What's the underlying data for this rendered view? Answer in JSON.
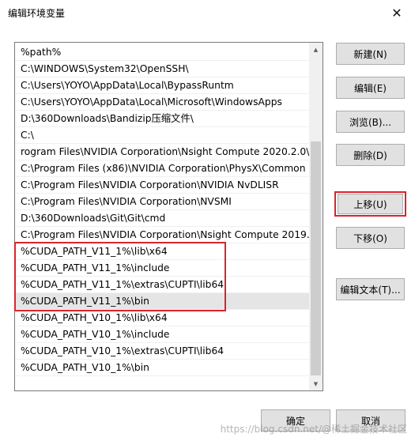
{
  "window": {
    "title": "编辑环境变量",
    "close_glyph": "✕"
  },
  "list": {
    "rows": [
      "%path%",
      "C:\\WINDOWS\\System32\\OpenSSH\\",
      "C:\\Users\\YOYO\\AppData\\Local\\BypassRuntm",
      "C:\\Users\\YOYO\\AppData\\Local\\Microsoft\\WindowsApps",
      "D:\\360Downloads\\Bandizip压缩文件\\",
      "C:\\",
      "rogram Files\\NVIDIA Corporation\\Nsight Compute 2020.2.0\\",
      "C:\\Program Files (x86)\\NVIDIA Corporation\\PhysX\\Common",
      "C:\\Program Files\\NVIDIA Corporation\\NVIDIA NvDLISR",
      "C:\\Program Files\\NVIDIA Corporation\\NVSMI",
      "D:\\360Downloads\\Git\\Git\\cmd",
      "C:\\Program Files\\NVIDIA Corporation\\Nsight Compute 2019....",
      "%CUDA_PATH_V11_1%\\lib\\x64",
      "%CUDA_PATH_V11_1%\\include",
      "%CUDA_PATH_V11_1%\\extras\\CUPTI\\lib64",
      "%CUDA_PATH_V11_1%\\bin",
      "%CUDA_PATH_V10_1%\\lib\\x64",
      "%CUDA_PATH_V10_1%\\include",
      "%CUDA_PATH_V10_1%\\extras\\CUPTI\\lib64",
      "%CUDA_PATH_V10_1%\\bin"
    ],
    "selected_index": 15
  },
  "buttons": {
    "new": "新建(N)",
    "edit": "编辑(E)",
    "browse": "浏览(B)...",
    "delete": "删除(D)",
    "move_up": "上移(U)",
    "move_down": "下移(O)",
    "edit_text": "编辑文本(T)...",
    "ok": "确定",
    "cancel": "取消"
  },
  "colors": {
    "highlight": "#d9252b",
    "selected_row": "#e5e5e5",
    "button_bg": "#e1e1e1"
  },
  "watermark": "https://blog.csdn.net/@稀土掘金技术社区"
}
